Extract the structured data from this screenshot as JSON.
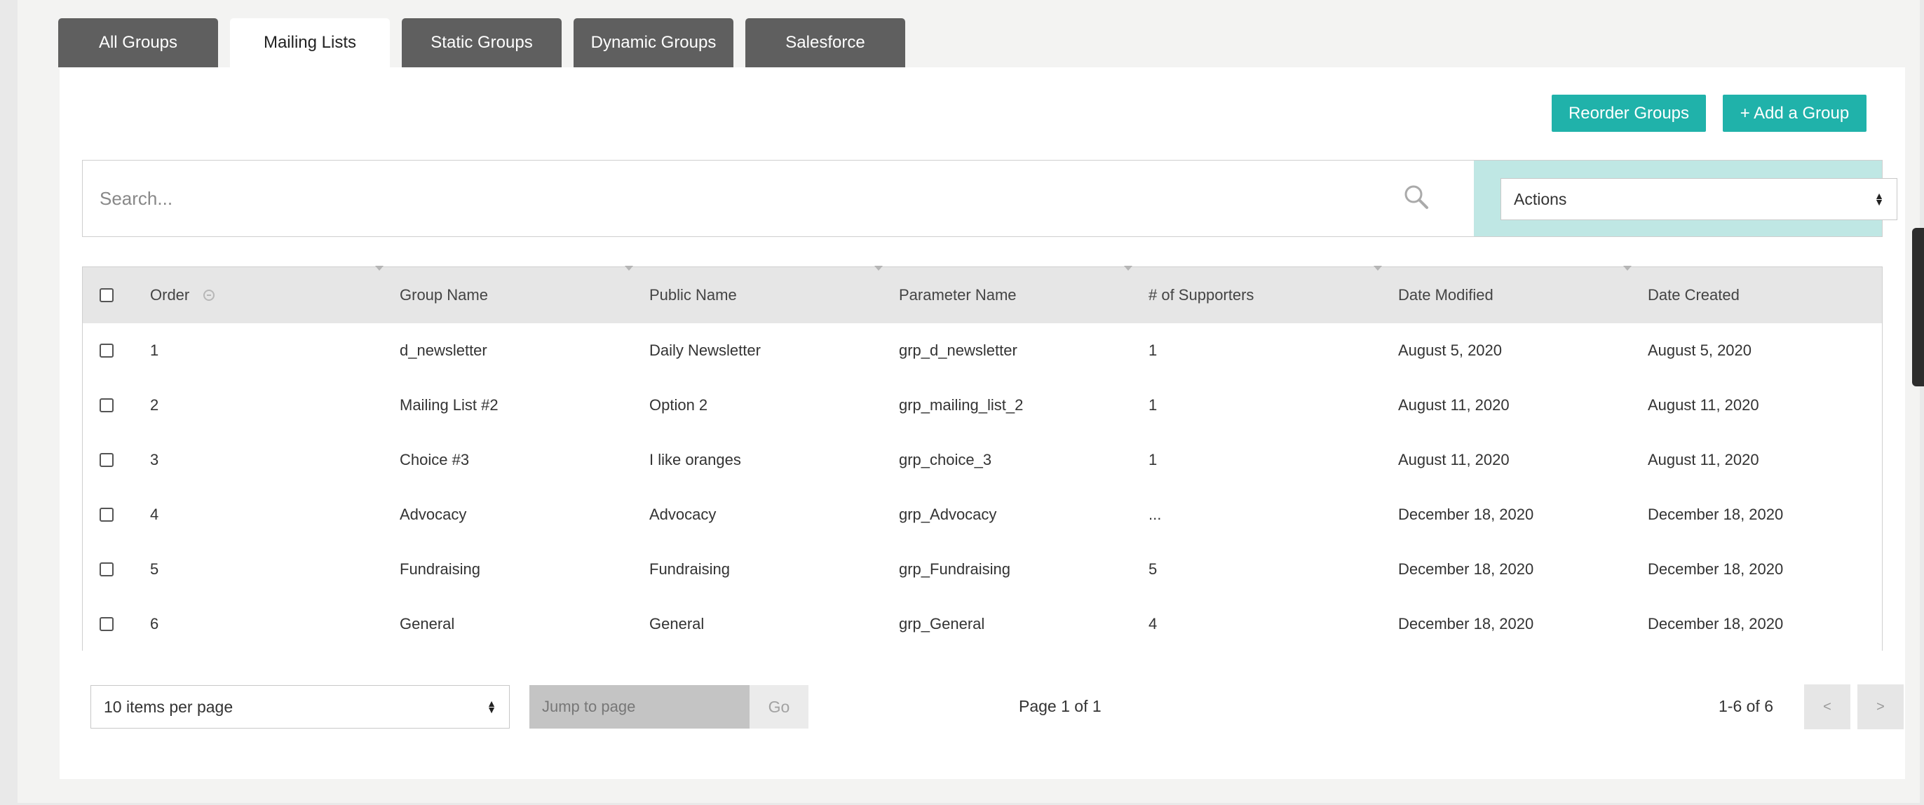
{
  "tabs": [
    "All Groups",
    "Mailing Lists",
    "Static Groups",
    "Dynamic Groups",
    "Salesforce"
  ],
  "active_tab": "Mailing Lists",
  "buttons": {
    "reorder": "Reorder Groups",
    "add": "+ Add a Group"
  },
  "search": {
    "placeholder": "Search..."
  },
  "actions": {
    "label": "Actions"
  },
  "table": {
    "headers": [
      "Order",
      "Group Name",
      "Public Name",
      "Parameter Name",
      "# of Supporters",
      "Date Modified",
      "Date Created"
    ],
    "rows": [
      [
        "1",
        "d_newsletter",
        "Daily Newsletter",
        "grp_d_newsletter",
        "1",
        "August 5, 2020",
        "August 5, 2020"
      ],
      [
        "2",
        "Mailing List #2",
        "Option 2",
        "grp_mailing_list_2",
        "1",
        "August 11, 2020",
        "August 11, 2020"
      ],
      [
        "3",
        "Choice #3",
        "I like oranges",
        "grp_choice_3",
        "1",
        "August 11, 2020",
        "August 11, 2020"
      ],
      [
        "4",
        "Advocacy",
        "Advocacy",
        "grp_Advocacy",
        "...",
        "December 18, 2020",
        "December 18, 2020"
      ],
      [
        "5",
        "Fundraising",
        "Fundraising",
        "grp_Fundraising",
        "5",
        "December 18, 2020",
        "December 18, 2020"
      ],
      [
        "6",
        "General",
        "General",
        "grp_General",
        "4",
        "December 18, 2020",
        "December 18, 2020"
      ]
    ]
  },
  "pagination": {
    "per_page": "10 items per page",
    "jump_placeholder": "Jump to page",
    "go": "Go",
    "page_info": "Page 1 of 1",
    "range": "1-6 of 6",
    "prev": "<",
    "next": ">"
  },
  "icons": {
    "search": "search-icon",
    "select": "up-down-arrows-icon",
    "order": "drag-handle-icon"
  },
  "colors": {
    "accent": "#20b2aa",
    "tab_inactive": "#5f5f5f",
    "actions_bg": "#bfe7e4"
  }
}
